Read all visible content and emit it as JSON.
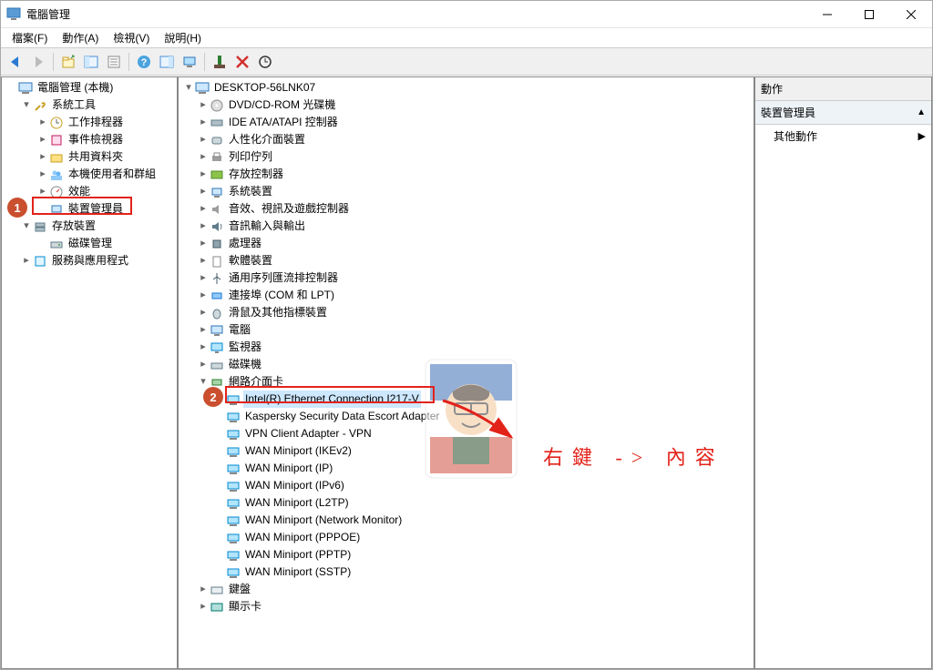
{
  "window": {
    "title": "電腦管理"
  },
  "menu": {
    "file": "檔案(F)",
    "action": "動作(A)",
    "view": "檢視(V)",
    "help": "說明(H)"
  },
  "left_tree": {
    "root": "電腦管理 (本機)",
    "systools": "系統工具",
    "task_sched": "工作排程器",
    "event_viewer": "事件檢視器",
    "shared": "共用資料夾",
    "users_groups": "本機使用者和群組",
    "perf": "效能",
    "devmgr": "裝置管理員",
    "storage": "存放裝置",
    "diskmgmt": "磁碟管理",
    "services": "服務與應用程式"
  },
  "mid_tree": {
    "root": "DESKTOP-56LNK07",
    "dvd": "DVD/CD-ROM 光碟機",
    "ide": "IDE ATA/ATAPI 控制器",
    "hid": "人性化介面裝置",
    "printq": "列印佇列",
    "storagectl": "存放控制器",
    "sysdev": "系統裝置",
    "svg": "音效、視訊及遊戲控制器",
    "audio": "音訊輸入與輸出",
    "cpu": "處理器",
    "swdev": "軟體裝置",
    "usb": "通用序列匯流排控制器",
    "ports": "連接埠 (COM 和 LPT)",
    "mouse": "滑鼠及其他指標裝置",
    "computer": "電腦",
    "monitor": "監視器",
    "disk": "磁碟機",
    "netadapter": "網路介面卡",
    "net_intel": "Intel(R) Ethernet Connection I217-V",
    "net_kaspersky": "Kaspersky Security Data Escort Adapter",
    "net_vpn": "VPN Client Adapter - VPN",
    "net_ikev2": "WAN Miniport (IKEv2)",
    "net_ip": "WAN Miniport (IP)",
    "net_ipv6": "WAN Miniport (IPv6)",
    "net_l2tp": "WAN Miniport (L2TP)",
    "net_mon": "WAN Miniport (Network Monitor)",
    "net_pppoe": "WAN Miniport (PPPOE)",
    "net_pptp": "WAN Miniport (PPTP)",
    "net_sstp": "WAN Miniport (SSTP)",
    "keyboard": "鍵盤",
    "display": "顯示卡"
  },
  "actions": {
    "title": "動作",
    "devmgr": "裝置管理員",
    "other": "其他動作"
  },
  "annotation": {
    "text": "右鍵 -> 內容",
    "badge1": "1",
    "badge2": "2"
  }
}
